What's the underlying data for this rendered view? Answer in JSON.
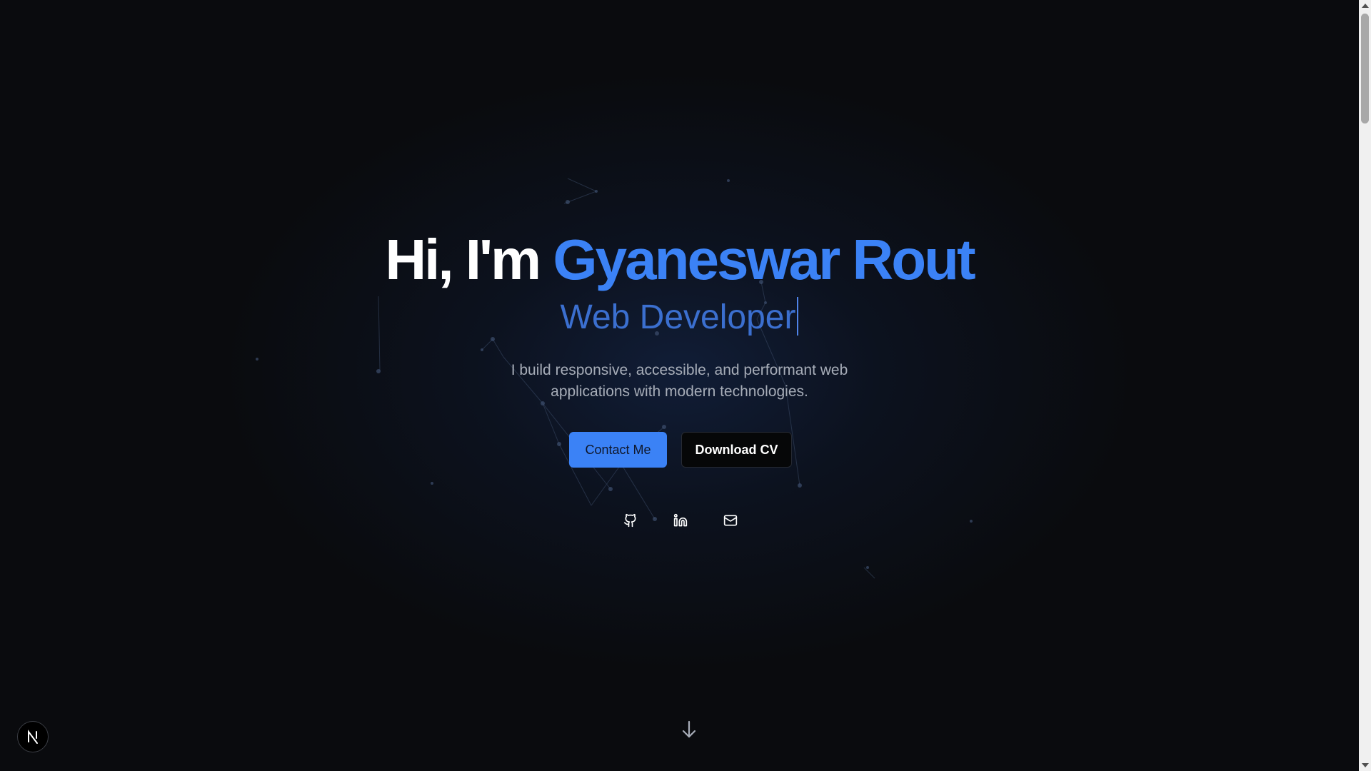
{
  "hero": {
    "greeting": "Hi, I'm ",
    "name": "Gyaneswar Rout",
    "role": "Web Developer",
    "description": "I build responsive, accessible, and performant web applications with modern technologies."
  },
  "actions": {
    "contact_label": "Contact Me",
    "download_label": "Download CV"
  },
  "socials": [
    {
      "name": "GitHub",
      "icon": "github-icon"
    },
    {
      "name": "LinkedIn",
      "icon": "linkedin-icon"
    },
    {
      "name": "Email",
      "icon": "mail-icon"
    }
  ],
  "scroll_indicator": {
    "icon": "arrow-down-icon"
  },
  "dev_badge": {
    "icon": "nextjs-logo-icon"
  },
  "colors": {
    "background": "#0a0b0e",
    "accent": "#3b82f6",
    "role_text": "#3b6fcf",
    "muted_text": "#a7adb8"
  }
}
